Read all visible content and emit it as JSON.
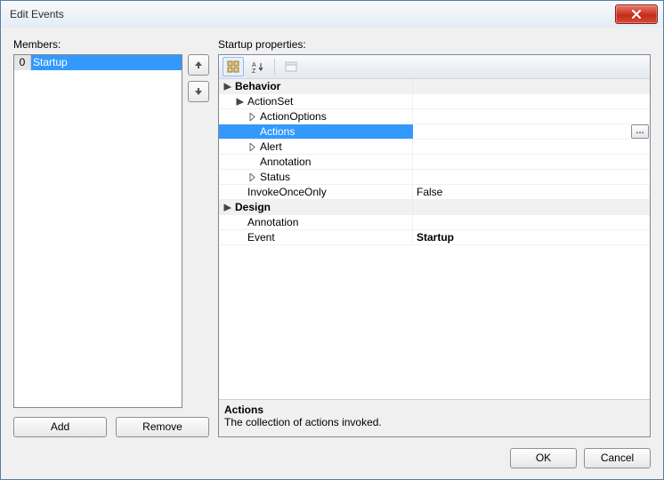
{
  "window": {
    "title": "Edit Events"
  },
  "left": {
    "label": "Members:",
    "items": [
      {
        "index": "0",
        "label": "Startup",
        "selected": true
      }
    ],
    "add_label": "Add",
    "remove_label": "Remove"
  },
  "right": {
    "label": "Startup properties:",
    "toolbar": {
      "categorized_icon": "categorized-icon",
      "alpha_icon": "alpha-sort-icon",
      "pages_icon": "property-pages-icon"
    },
    "rows": {
      "cat_behavior": "Behavior",
      "actionset": "ActionSet",
      "actionoptions": "ActionOptions",
      "actions": "Actions",
      "alert": "Alert",
      "annotation_child": "Annotation",
      "status": "Status",
      "invokeonceonly": "InvokeOnceOnly",
      "invokeonceonly_val": "False",
      "cat_design": "Design",
      "annotation": "Annotation",
      "event": "Event",
      "event_val": "Startup"
    },
    "desc": {
      "title": "Actions",
      "text": "The collection of actions invoked."
    }
  },
  "buttons": {
    "ok": "OK",
    "cancel": "Cancel"
  }
}
